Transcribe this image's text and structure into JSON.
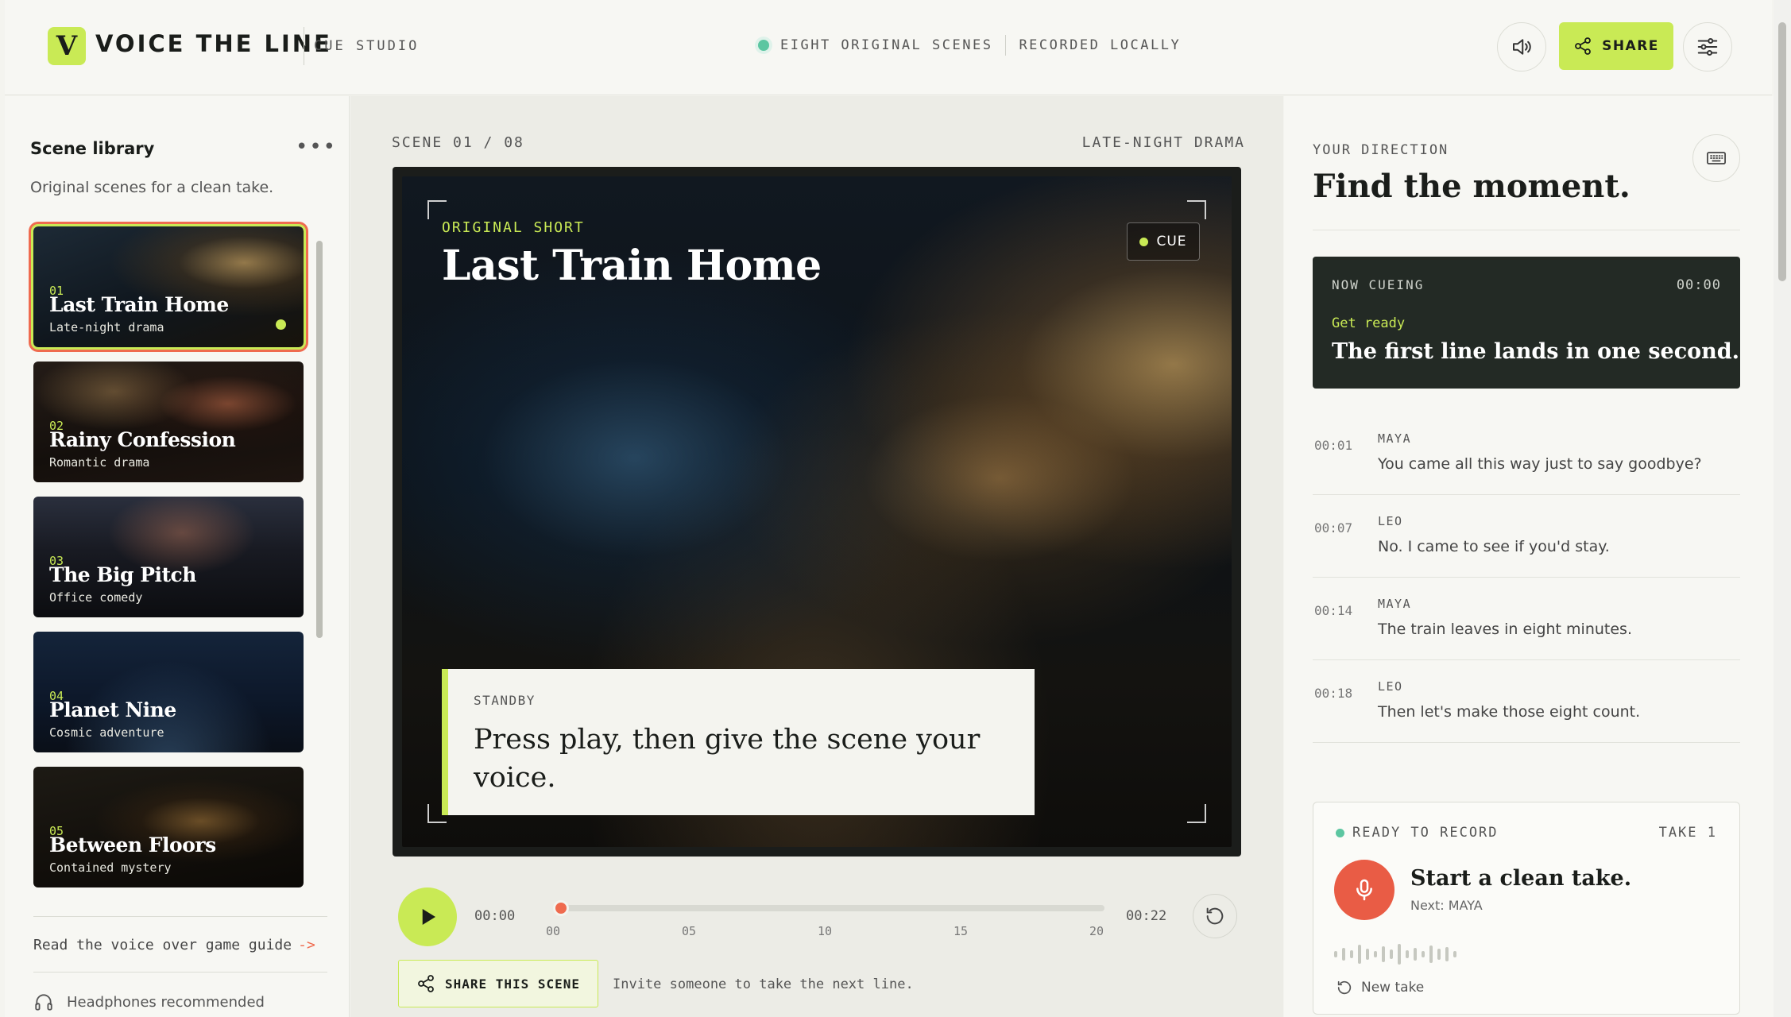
{
  "app": {
    "logo_letter": "V",
    "title": "VOICE THE LINE",
    "subtitle": "CUE STUDIO",
    "status_scenes": "EIGHT ORIGINAL SCENES",
    "status_local": "RECORDED LOCALLY",
    "share_label": "SHARE",
    "accent": "#c9ea55",
    "record_red": "#e95c45"
  },
  "sidebar": {
    "title": "Scene library",
    "more": "•••",
    "description": "Original scenes for a clean take.",
    "scenes": [
      {
        "num": "01",
        "name": "Last Train Home",
        "genre": "Late-night drama",
        "active": true
      },
      {
        "num": "02",
        "name": "Rainy Confession",
        "genre": "Romantic drama"
      },
      {
        "num": "03",
        "name": "The Big Pitch",
        "genre": "Office comedy"
      },
      {
        "num": "04",
        "name": "Planet Nine",
        "genre": "Cosmic adventure"
      },
      {
        "num": "05",
        "name": "Between Floors",
        "genre": "Contained mystery"
      }
    ],
    "guide_link": "Read the voice over game guide",
    "guide_arrow": "->",
    "headphones": "Headphones recommended"
  },
  "stage": {
    "scene_index": "SCENE 01 / 08",
    "genre": "LATE-NIGHT DRAMA",
    "label": "ORIGINAL SHORT",
    "title": "Last Train Home",
    "cue_badge": "CUE",
    "standby_label": "STANDBY",
    "standby_text": "Press play, then give the scene your voice."
  },
  "player": {
    "time_current": "00:00",
    "time_total": "00:22",
    "ticks": [
      "00",
      "05",
      "10",
      "15",
      "20"
    ],
    "progress": 0,
    "share_scene_label": "SHARE THIS SCENE",
    "invite_text": "Invite someone to take the next line."
  },
  "direction": {
    "label": "YOUR DIRECTION",
    "title": "Find the moment.",
    "now_label": "NOW CUEING",
    "now_time": "00:00",
    "now_ready": "Get ready",
    "now_text": "The first line lands in one second.",
    "lines": [
      {
        "time": "00:01",
        "speaker": "MAYA",
        "text": "You came all this way just to say goodbye?"
      },
      {
        "time": "00:07",
        "speaker": "LEO",
        "text": "No. I came to see if you'd stay."
      },
      {
        "time": "00:14",
        "speaker": "MAYA",
        "text": "The train leaves in eight minutes."
      },
      {
        "time": "00:18",
        "speaker": "LEO",
        "text": "Then let's make those eight count."
      }
    ]
  },
  "record": {
    "status": "READY TO RECORD",
    "take": "TAKE 1",
    "title": "Start a clean take.",
    "next": "Next: MAYA",
    "new_take": "New take"
  }
}
